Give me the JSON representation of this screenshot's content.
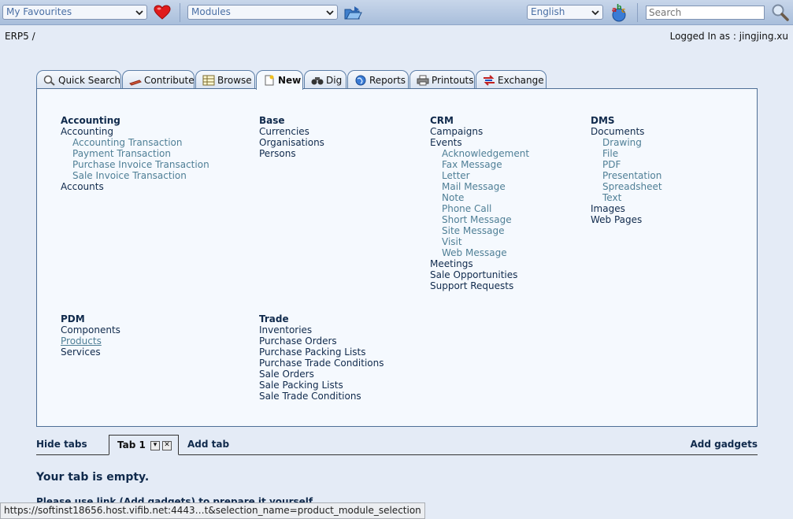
{
  "toolbar": {
    "favourites_label": "My Favourites",
    "modules_label": "Modules",
    "language_label": "English",
    "search_placeholder": "Search"
  },
  "header": {
    "breadcrumb": "ERP5 /",
    "logged_in": "Logged In as : jingjing.xu"
  },
  "tabs": [
    {
      "label": "Quick Search",
      "icon": "magnifier-icon"
    },
    {
      "label": "Contribute",
      "icon": "pen-icon"
    },
    {
      "label": "Browse",
      "icon": "table-icon"
    },
    {
      "label": "New",
      "icon": "new-document-icon",
      "active": true
    },
    {
      "label": "Dig",
      "icon": "binoculars-icon"
    },
    {
      "label": "Reports",
      "icon": "globe-icon"
    },
    {
      "label": "Printouts",
      "icon": "printer-icon"
    },
    {
      "label": "Exchange",
      "icon": "exchange-icon"
    }
  ],
  "modules": {
    "accounting": {
      "heading": "Accounting",
      "items": [
        "Accounting",
        "Accounting Transaction",
        "Payment Transaction",
        "Purchase Invoice Transaction",
        "Sale Invoice Transaction",
        "Accounts"
      ]
    },
    "base": {
      "heading": "Base",
      "items": [
        "Currencies",
        "Organisations",
        "Persons"
      ]
    },
    "crm": {
      "heading": "CRM",
      "items": [
        "Campaigns",
        "Events",
        "Acknowledgement",
        "Fax Message",
        "Letter",
        "Mail Message",
        "Note",
        "Phone Call",
        "Short Message",
        "Site Message",
        "Visit",
        "Web Message",
        "Meetings",
        "Sale Opportunities",
        "Support Requests"
      ]
    },
    "dms": {
      "heading": "DMS",
      "items": [
        "Documents",
        "Drawing",
        "File",
        "PDF",
        "Presentation",
        "Spreadsheet",
        "Text",
        "Images",
        "Web Pages"
      ]
    },
    "pdm": {
      "heading": "PDM",
      "items": [
        "Components",
        "Products",
        "Services"
      ]
    },
    "trade": {
      "heading": "Trade",
      "items": [
        "Inventories",
        "Purchase Orders",
        "Purchase Packing Lists",
        "Purchase Trade Conditions",
        "Sale Orders",
        "Sale Packing Lists",
        "Sale Trade Conditions"
      ]
    }
  },
  "gadgets": {
    "hide_tabs": "Hide tabs",
    "tab1": "Tab 1",
    "add_tab": "Add tab",
    "add_gadgets": "Add gadgets",
    "empty_title": "Your tab is empty.",
    "empty_hint": "Please use link (Add gadgets) to prepare it yourself."
  },
  "status_url": "https://softinst18656.host.vifib.net:4443…t&selection_name=product_module_selection",
  "colors": {
    "page_bg": "#e4ebf6",
    "panel_bg": "#f5f9fe",
    "heading": "#102a4c",
    "sub_link": "#4f7f96"
  }
}
